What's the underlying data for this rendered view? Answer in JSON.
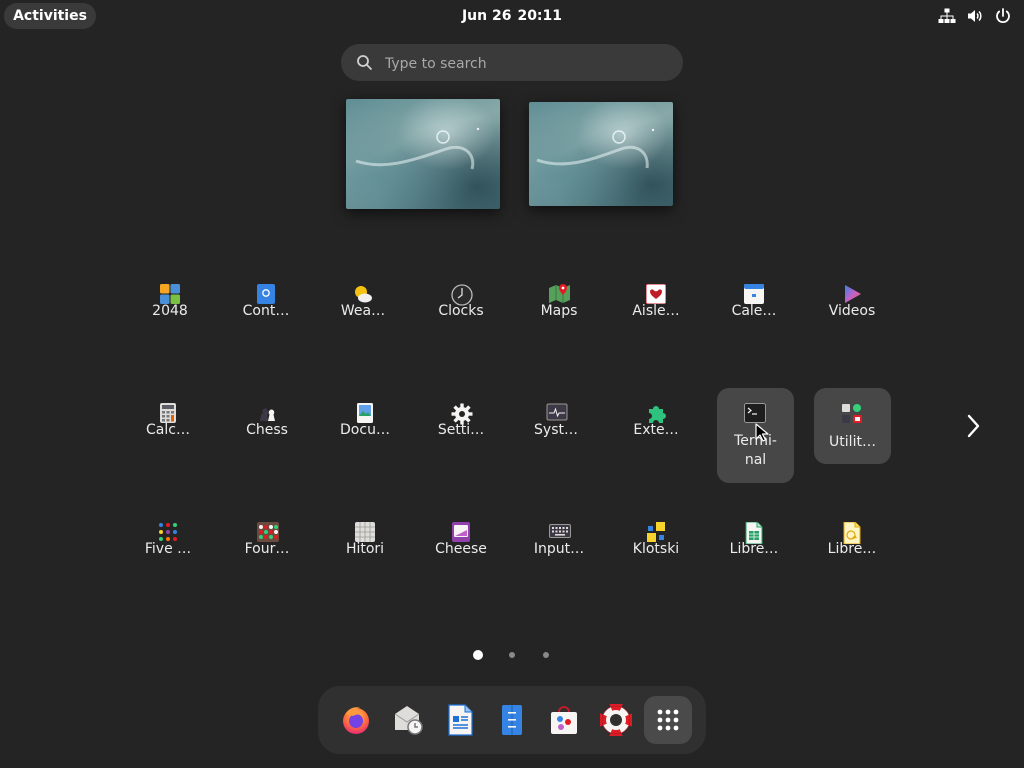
{
  "topbar": {
    "activities": "Activities",
    "date": "Jun 26",
    "time": "20:11",
    "icons": [
      "network-icon",
      "volume-icon",
      "power-icon"
    ]
  },
  "search": {
    "placeholder": "Type to search"
  },
  "workspaces": [
    "workspace-1",
    "workspace-2"
  ],
  "app_grid": {
    "rows": [
      [
        {
          "label": "2048",
          "icon": "2048-icon"
        },
        {
          "label": "Cont…",
          "icon": "contacts-icon"
        },
        {
          "label": "Wea…",
          "icon": "weather-icon"
        },
        {
          "label": "Clocks",
          "icon": "clocks-icon"
        },
        {
          "label": "Maps",
          "icon": "maps-icon"
        },
        {
          "label": "Aisle…",
          "icon": "aisleriot-icon"
        },
        {
          "label": "Cale…",
          "icon": "calendar-icon"
        },
        {
          "label": "Videos",
          "icon": "videos-icon"
        }
      ],
      [
        {
          "label": "Calc…",
          "icon": "calculator-icon"
        },
        {
          "label": "Chess",
          "icon": "chess-icon"
        },
        {
          "label": "Docu…",
          "icon": "document-viewer-icon"
        },
        {
          "label": "Setti…",
          "icon": "settings-icon"
        },
        {
          "label": "Syst…",
          "icon": "system-monitor-icon"
        },
        {
          "label": "Exte…",
          "icon": "extensions-icon"
        },
        {
          "label": "Termi-\nnal",
          "icon": "terminal-icon"
        },
        {
          "label": "Utilit…",
          "icon": "utilities-folder-icon"
        }
      ],
      [
        {
          "label": "Five …",
          "icon": "five-or-more-icon"
        },
        {
          "label": "Four…",
          "icon": "four-in-a-row-icon"
        },
        {
          "label": "Hitori",
          "icon": "hitori-icon"
        },
        {
          "label": "Cheese",
          "icon": "cheese-icon"
        },
        {
          "label": "Input…",
          "icon": "input-method-icon"
        },
        {
          "label": "Klotski",
          "icon": "klotski-icon"
        },
        {
          "label": "Libre…",
          "icon": "libreoffice-calc-icon"
        },
        {
          "label": "Libre…",
          "icon": "libreoffice-draw-icon"
        }
      ]
    ],
    "page_indicator": {
      "pages": 3,
      "current": 1
    }
  },
  "dash": {
    "items": [
      {
        "name": "Firefox",
        "icon": "firefox-icon"
      },
      {
        "name": "Evolution",
        "icon": "mail-clock-icon"
      },
      {
        "name": "LibreOffice Writer",
        "icon": "libreoffice-writer-icon"
      },
      {
        "name": "Text Editor",
        "icon": "text-editor-icon"
      },
      {
        "name": "Software",
        "icon": "software-icon"
      },
      {
        "name": "Help",
        "icon": "help-lifebuoy-icon"
      },
      {
        "name": "Show Applications",
        "icon": "app-grid-icon"
      }
    ]
  },
  "colors": {
    "background": "#242424",
    "pill": "#3a3a3a",
    "highlight": "#474747",
    "dash": "#303030"
  }
}
